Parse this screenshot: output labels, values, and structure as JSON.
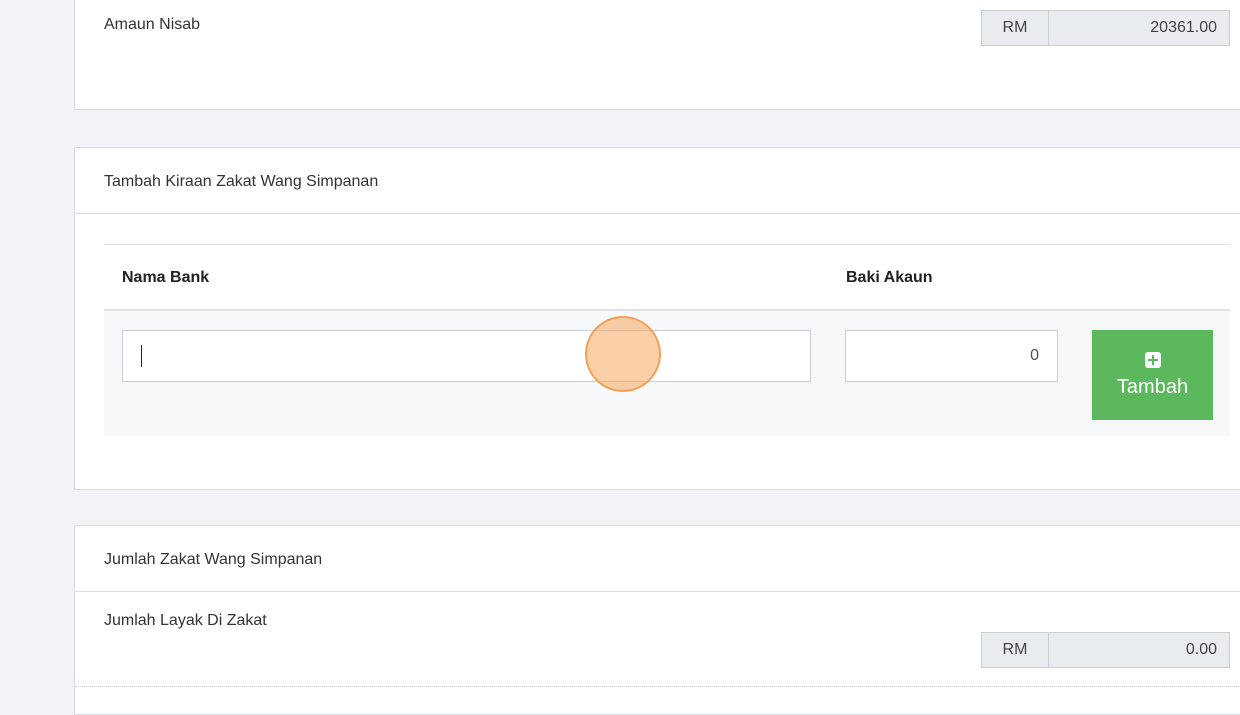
{
  "nisab": {
    "label": "Amaun Nisab",
    "currency": "RM",
    "value": "20361.00"
  },
  "add_section": {
    "title": "Tambah Kiraan Zakat Wang Simpanan",
    "columns": [
      "Nama Bank",
      "Baki Akaun"
    ],
    "bank_name_value": "",
    "balance_value": "0",
    "add_button_label": "Tambah",
    "add_button_icon": "plus-square-icon",
    "accent_color": "#5cb85c"
  },
  "total_section": {
    "title": "Jumlah Zakat Wang Simpanan",
    "eligible_label": "Jumlah Layak Di Zakat",
    "currency": "RM",
    "eligible_value": "0.00"
  }
}
